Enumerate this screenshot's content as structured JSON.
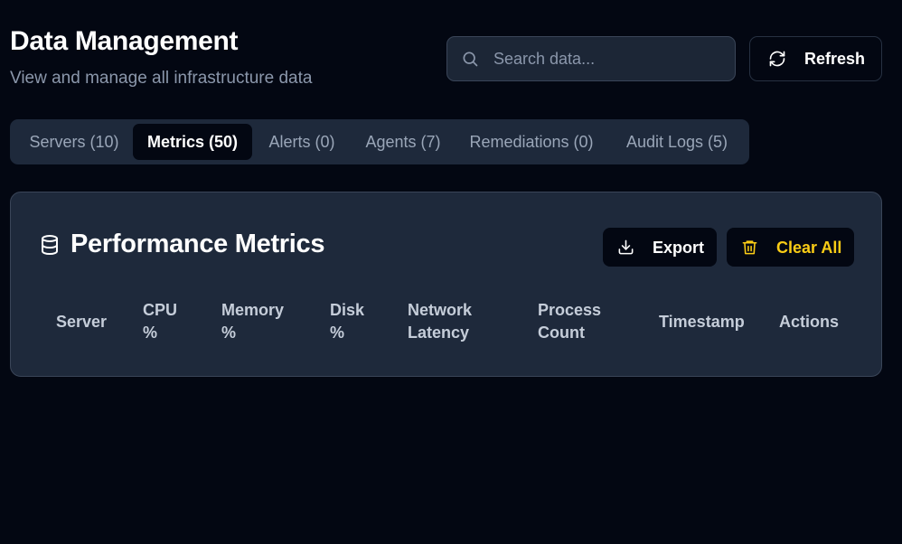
{
  "header": {
    "title": "Data Management",
    "subtitle": "View and manage all infrastructure data"
  },
  "search": {
    "placeholder": "Search data...",
    "icon": "search-icon"
  },
  "refresh": {
    "label": "Refresh",
    "icon": "refresh-icon"
  },
  "tabs": [
    {
      "label": "Servers (10)",
      "active": false
    },
    {
      "label": "Metrics (50)",
      "active": true
    },
    {
      "label": "Alerts (0)",
      "active": false
    },
    {
      "label": "Agents (7)",
      "active": false
    },
    {
      "label": "Remediations (0)",
      "active": false
    },
    {
      "label": "Audit Logs (5)",
      "active": false
    }
  ],
  "panel": {
    "title": "Performance Metrics",
    "icon": "database-icon",
    "export_label": "Export",
    "clear_label": "Clear All",
    "columns": [
      "Server",
      "CPU\n%",
      "Memory\n%",
      "Disk\n%",
      "Network\nLatency",
      "Process\nCount",
      "Timestamp",
      "Actions"
    ]
  },
  "colors": {
    "background": "#030712",
    "panel": "#1e293b",
    "danger_accent": "#facc15",
    "muted_text": "#8b97ab"
  }
}
